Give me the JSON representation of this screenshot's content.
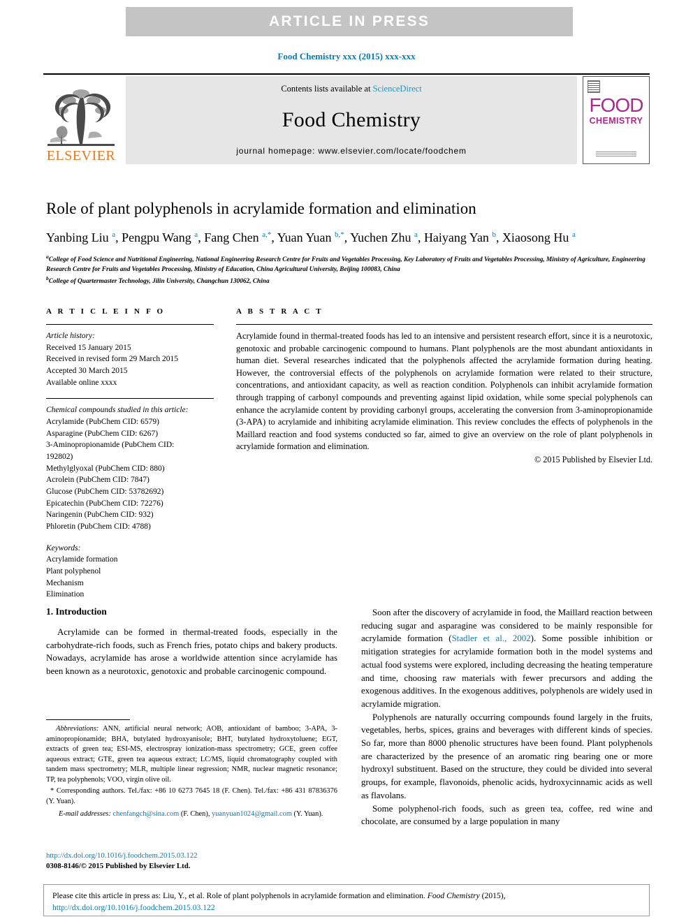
{
  "banner": {
    "text": "ARTICLE  IN  PRESS"
  },
  "running_head": "Food Chemistry xxx (2015) xxx-xxx",
  "masthead": {
    "contents_prefix": "Contents lists available at ",
    "sciencedirect": "ScienceDirect",
    "journal_title": "Food Chemistry",
    "homepage": "journal homepage: www.elsevier.com/locate/foodchem",
    "elsevier_word": "ELSEVIER",
    "cover_food": "FOOD",
    "cover_chemistry": "CHEMISTRY"
  },
  "article": {
    "title": "Role of plant polyphenols in acrylamide formation and elimination",
    "authors_html": "Yanbing Liu <sup>a</sup>, Pengpu Wang <sup>a</sup>, Fang Chen <sup>a,*</sup>, Yuan Yuan <sup>b,*</sup>, Yuchen Zhu <sup>a</sup>, Haiyang Yan <sup>b</sup>, Xiaosong Hu <sup>a</sup>",
    "affiliation_a": "College of Food Science and Nutritional Engineering, National Engineering Research Centre for Fruits and Vegetables Processing, Key Laboratory of Fruits and Vegetables Processing, Ministry of Agriculture, Engineering Research Centre for Fruits and Vegetables Processing, Ministry of Education, China Agricultural University, Beijing 100083, China",
    "affiliation_b": "College of Quartermaster Technology, Jilin University, Changchun 130062, China"
  },
  "article_info": {
    "heading": "A R T I C L E   I N F O",
    "history_label": "Article history:",
    "history": [
      "Received 15 January 2015",
      "Received in revised form 29 March 2015",
      "Accepted 30 March 2015",
      "Available online xxxx"
    ],
    "compounds_label": "Chemical compounds studied in this article:",
    "compounds": [
      "Acrylamide (PubChem CID: 6579)",
      "Asparagine (PubChem CID: 6267)",
      "3-Aminopropionamide (PubChem CID:",
      "192802)",
      "Methylglyoxal (PubChem CID: 880)",
      "Acrolein (PubChem CID: 7847)",
      "Glucose (PubChem CID: 53782692)",
      "Epicatechin (PubChem CID: 72276)",
      "Naringenin (PubChem CID: 932)",
      "Phloretin (PubChem CID: 4788)"
    ],
    "keywords_label": "Keywords:",
    "keywords": [
      "Acrylamide formation",
      "Plant polyphenol",
      "Mechanism",
      "Elimination"
    ]
  },
  "abstract": {
    "heading": "A B S T R A C T",
    "body": "Acrylamide found in thermal-treated foods has led to an intensive and persistent research effort, since it is a neurotoxic, genotoxic and probable carcinogenic compound to humans. Plant polyphenols are the most abundant antioxidants in human diet. Several researches indicated that the polyphenols affected the acrylamide formation during heating. However, the controversial effects of the polyphenols on acrylamide formation were related to their structure, concentrations, and antioxidant capacity, as well as reaction condition. Polyphenols can inhibit acrylamide formation through trapping of carbonyl compounds and preventing against lipid oxidation, while some special polyphenols can enhance the acrylamide content by providing carbonyl groups, accelerating the conversion from 3-aminopropionamide (3-APA) to acrylamide and inhibiting acrylamide elimination. This review concludes the effects of polyphenols in the Maillard reaction and food systems conducted so far, aimed to give an overview on the role of plant polyphenols in acrylamide formation and elimination.",
    "copyright": "© 2015 Published by Elsevier Ltd."
  },
  "introduction": {
    "section_title": "1. Introduction",
    "left_para_1": "Acrylamide can be formed in thermal-treated foods, especially in the carbohydrate-rich foods, such as French fries, potato chips and bakery products. Nowadays, acrylamide has arose a worldwide attention since acrylamide has been known as a neurotoxic, genotoxic and probable carcinogenic compound.",
    "right_para_1_pre": "Soon after the discovery of acrylamide in food, the Maillard reaction between reducing sugar and asparagine was considered to be mainly responsible for acrylamide formation (",
    "right_para_1_cite": "Stadler et al., 2002",
    "right_para_1_post": "). Some possible inhibition or mitigation strategies for acrylamide formation both in the model systems and actual food systems were explored, including decreasing the heating temperature and time, choosing raw materials with fewer precursors and adding the exogenous additives. In the exogenous additives, polyphenols are widely used in acrylamide migration.",
    "right_para_2": "Polyphenols are naturally occurring compounds found largely in the fruits, vegetables, herbs, spices, grains and beverages with different kinds of species. So far, more than 8000 phenolic structures have been found. Plant polyphenols are characterized by the presence of an aromatic ring bearing one or more hydroxyl substituent. Based on the structure, they could be divided into several groups, for example, flavonoids, phenolic acids, hydroxycinnamic acids as well as flavolans.",
    "right_para_3": "Some polyphenol-rich foods, such as green tea, coffee, red wine and chocolate, are consumed by a large population in many"
  },
  "footnotes": {
    "abbrev_label": "Abbreviations:",
    "abbrev_text": " ANN, artificial neural network; AOB, antioxidant of bamboo; 3-APA, 3-aminopropionamide; BHA, butylated hydroxyanisole; BHT, butylated hydroxytoluene; EGT, extracts of green tea; ESI-MS, electrospray ionization-mass spectrometry; GCE, green coffee aqueous extract; GTE, green tea aqueous extract; LC/MS, liquid chromatography coupled with tandem mass spectrometry; MLR, multiple linear regression; NMR, nuclear magnetic resonance; TP, tea polyphenols; VOO, virgin olive oil.",
    "corresponding": "* Corresponding authors. Tel./fax: +86 10 6273 7645 18 (F. Chen). Tel./fax: +86 431 87836376 (Y. Yuan).",
    "email_label": "E-mail addresses:",
    "email_1": "chenfangch@sina.com",
    "email_1_suffix": " (F. Chen), ",
    "email_2": "yuanyuan1024@gmail.com",
    "email_2_suffix": " (Y. Yuan)."
  },
  "doi_footer": {
    "doi_url": "http://dx.doi.org/10.1016/j.foodchem.2015.03.122",
    "issn_line": "0308-8146/© 2015 Published by Elsevier Ltd."
  },
  "citation_box": {
    "prefix": "Please cite this article in press as: Liu, Y., et al. Role of plant polyphenols in acrylamide formation and elimination. ",
    "journal": "Food Chemistry",
    "middle": " (2015), ",
    "link": "http://dx.doi.org/10.1016/j.foodchem.2015.03.122"
  },
  "colors": {
    "link_blue": "#0b7ab0",
    "sciencedirect_blue": "#2196c4",
    "elsevier_orange": "#e87722",
    "cover_magenta": "#a72a8c",
    "banner_gray": "#c4c4c4"
  }
}
